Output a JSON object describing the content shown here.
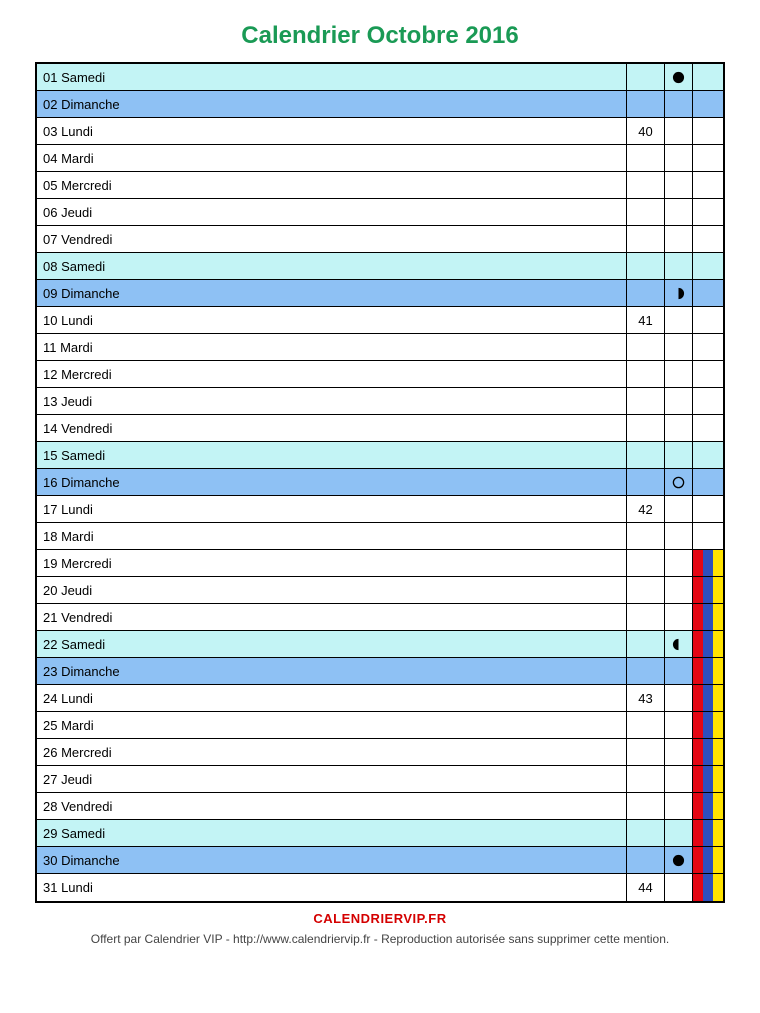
{
  "title": "Calendrier Octobre 2016",
  "site": "CALENDRIERVIP.FR",
  "footer": "Offert par Calendrier VIP - http://www.calendriervip.fr - Reproduction autorisée sans supprimer cette mention.",
  "colors": {
    "saturday": "#c3f4f5",
    "sunday": "#8ec1f4",
    "weekday": "#ffffff",
    "titleGreen": "#1a9a55",
    "siteRed": "#d40000",
    "zoneA_red": "#e30613",
    "zoneB_blue": "#2d4fbd",
    "zoneC_yellow": "#ffe300"
  },
  "days": [
    {
      "num": "01",
      "name": "Samedi",
      "type": "sat",
      "week": "",
      "moon": "new",
      "zones": [
        false,
        false,
        false
      ]
    },
    {
      "num": "02",
      "name": "Dimanche",
      "type": "sun",
      "week": "",
      "moon": "",
      "zones": [
        false,
        false,
        false
      ]
    },
    {
      "num": "03",
      "name": "Lundi",
      "type": "wk",
      "week": "40",
      "moon": "",
      "zones": [
        false,
        false,
        false
      ]
    },
    {
      "num": "04",
      "name": "Mardi",
      "type": "wk",
      "week": "",
      "moon": "",
      "zones": [
        false,
        false,
        false
      ]
    },
    {
      "num": "05",
      "name": "Mercredi",
      "type": "wk",
      "week": "",
      "moon": "",
      "zones": [
        false,
        false,
        false
      ]
    },
    {
      "num": "06",
      "name": "Jeudi",
      "type": "wk",
      "week": "",
      "moon": "",
      "zones": [
        false,
        false,
        false
      ]
    },
    {
      "num": "07",
      "name": "Vendredi",
      "type": "wk",
      "week": "",
      "moon": "",
      "zones": [
        false,
        false,
        false
      ]
    },
    {
      "num": "08",
      "name": "Samedi",
      "type": "sat",
      "week": "",
      "moon": "",
      "zones": [
        false,
        false,
        false
      ]
    },
    {
      "num": "09",
      "name": "Dimanche",
      "type": "sun",
      "week": "",
      "moon": "firstq",
      "zones": [
        false,
        false,
        false
      ]
    },
    {
      "num": "10",
      "name": "Lundi",
      "type": "wk",
      "week": "41",
      "moon": "",
      "zones": [
        false,
        false,
        false
      ]
    },
    {
      "num": "11",
      "name": "Mardi",
      "type": "wk",
      "week": "",
      "moon": "",
      "zones": [
        false,
        false,
        false
      ]
    },
    {
      "num": "12",
      "name": "Mercredi",
      "type": "wk",
      "week": "",
      "moon": "",
      "zones": [
        false,
        false,
        false
      ]
    },
    {
      "num": "13",
      "name": "Jeudi",
      "type": "wk",
      "week": "",
      "moon": "",
      "zones": [
        false,
        false,
        false
      ]
    },
    {
      "num": "14",
      "name": "Vendredi",
      "type": "wk",
      "week": "",
      "moon": "",
      "zones": [
        false,
        false,
        false
      ]
    },
    {
      "num": "15",
      "name": "Samedi",
      "type": "sat",
      "week": "",
      "moon": "",
      "zones": [
        false,
        false,
        false
      ]
    },
    {
      "num": "16",
      "name": "Dimanche",
      "type": "sun",
      "week": "",
      "moon": "full",
      "zones": [
        false,
        false,
        false
      ]
    },
    {
      "num": "17",
      "name": "Lundi",
      "type": "wk",
      "week": "42",
      "moon": "",
      "zones": [
        false,
        false,
        false
      ]
    },
    {
      "num": "18",
      "name": "Mardi",
      "type": "wk",
      "week": "",
      "moon": "",
      "zones": [
        false,
        false,
        false
      ]
    },
    {
      "num": "19",
      "name": "Mercredi",
      "type": "wk",
      "week": "",
      "moon": "",
      "zones": [
        true,
        true,
        true
      ]
    },
    {
      "num": "20",
      "name": "Jeudi",
      "type": "wk",
      "week": "",
      "moon": "",
      "zones": [
        true,
        true,
        true
      ]
    },
    {
      "num": "21",
      "name": "Vendredi",
      "type": "wk",
      "week": "",
      "moon": "",
      "zones": [
        true,
        true,
        true
      ]
    },
    {
      "num": "22",
      "name": "Samedi",
      "type": "sat",
      "week": "",
      "moon": "lastq",
      "zones": [
        true,
        true,
        true
      ]
    },
    {
      "num": "23",
      "name": "Dimanche",
      "type": "sun",
      "week": "",
      "moon": "",
      "zones": [
        true,
        true,
        true
      ]
    },
    {
      "num": "24",
      "name": "Lundi",
      "type": "wk",
      "week": "43",
      "moon": "",
      "zones": [
        true,
        true,
        true
      ]
    },
    {
      "num": "25",
      "name": "Mardi",
      "type": "wk",
      "week": "",
      "moon": "",
      "zones": [
        true,
        true,
        true
      ]
    },
    {
      "num": "26",
      "name": "Mercredi",
      "type": "wk",
      "week": "",
      "moon": "",
      "zones": [
        true,
        true,
        true
      ]
    },
    {
      "num": "27",
      "name": "Jeudi",
      "type": "wk",
      "week": "",
      "moon": "",
      "zones": [
        true,
        true,
        true
      ]
    },
    {
      "num": "28",
      "name": "Vendredi",
      "type": "wk",
      "week": "",
      "moon": "",
      "zones": [
        true,
        true,
        true
      ]
    },
    {
      "num": "29",
      "name": "Samedi",
      "type": "sat",
      "week": "",
      "moon": "",
      "zones": [
        true,
        true,
        true
      ]
    },
    {
      "num": "30",
      "name": "Dimanche",
      "type": "sun",
      "week": "",
      "moon": "new",
      "zones": [
        true,
        true,
        true
      ]
    },
    {
      "num": "31",
      "name": "Lundi",
      "type": "wk",
      "week": "44",
      "moon": "",
      "zones": [
        true,
        true,
        true
      ]
    }
  ]
}
